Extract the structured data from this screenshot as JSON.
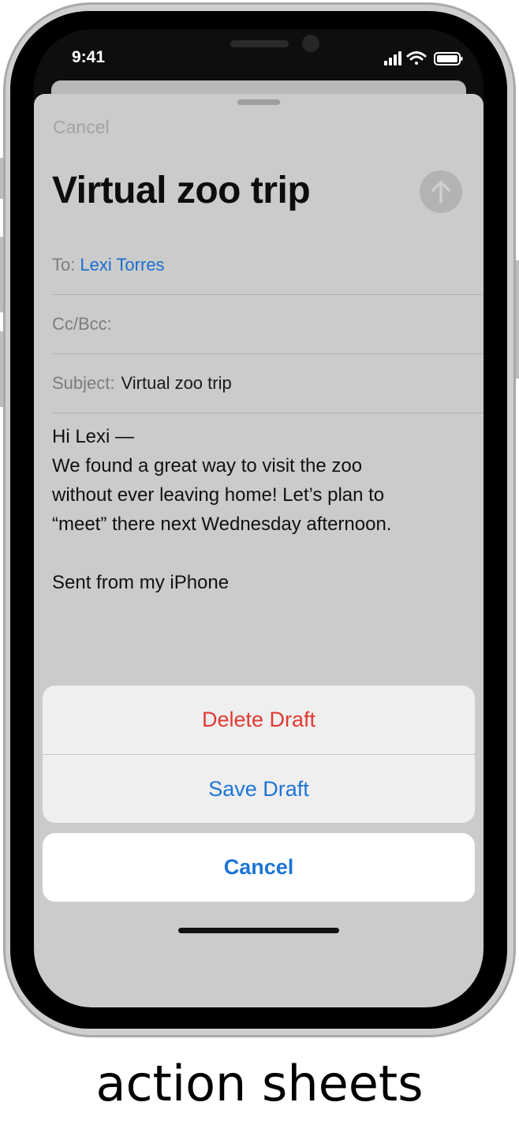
{
  "status_bar": {
    "time": "9:41",
    "icons": [
      "cellular-signal-icon",
      "wifi-icon",
      "battery-icon"
    ]
  },
  "compose": {
    "cancel_label": "Cancel",
    "title": "Virtual zoo trip",
    "send_icon": "arrow-up-icon",
    "to_label": "To:",
    "to_value": "Lexi Torres",
    "cc_label": "Cc/Bcc:",
    "subject_label": "Subject:",
    "subject_value": "Virtual zoo trip",
    "body_lines": [
      "Hi Lexi —",
      "We found a great way to visit the zoo",
      "without ever leaving home! Let’s plan to",
      "“meet” there next Wednesday afternoon.",
      "",
      "Sent from my iPhone"
    ]
  },
  "action_sheet": {
    "delete_label": "Delete Draft",
    "save_label": "Save Draft",
    "cancel_label": "Cancel"
  },
  "colors": {
    "link_blue": "#1d75d6",
    "destructive_red": "#e03a32"
  },
  "caption": "action sheets"
}
